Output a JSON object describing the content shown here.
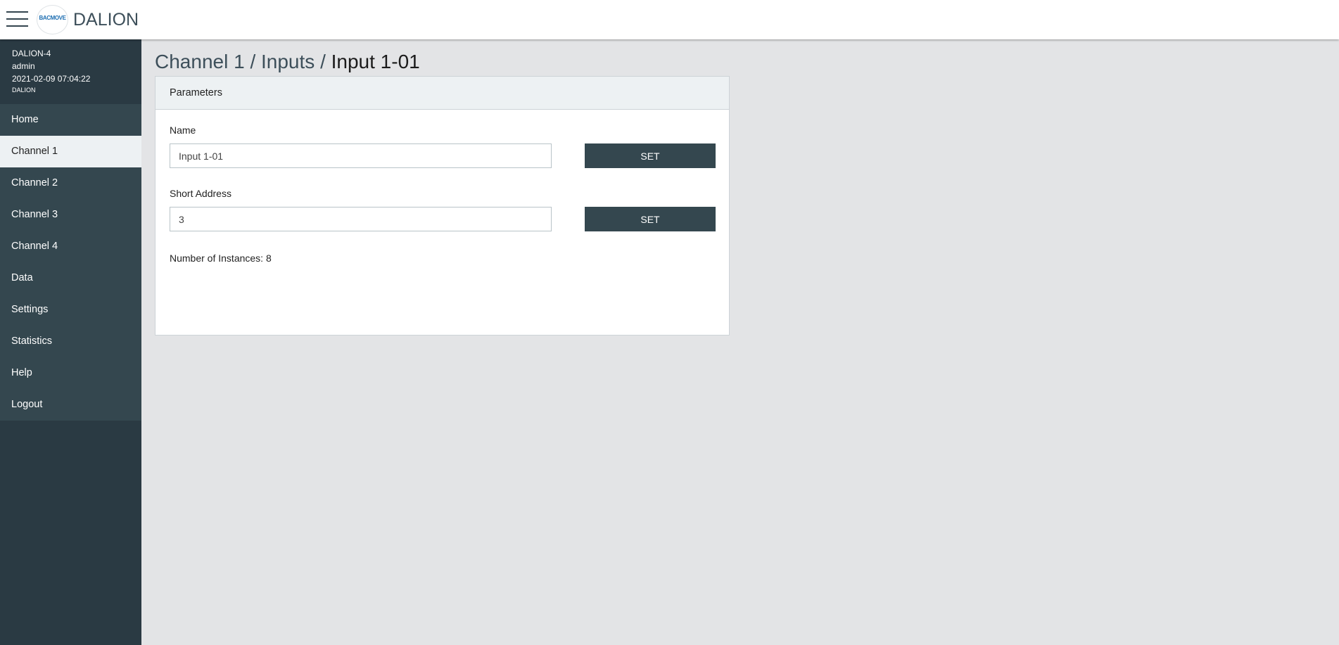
{
  "header": {
    "logo_text": "BACMOVE",
    "app_title": "DALION"
  },
  "user_info": {
    "device": "DALION-4",
    "user": "admin",
    "datetime": "2021-02-09 07:04:22",
    "product": "DALION"
  },
  "sidebar": {
    "items": [
      {
        "label": "Home"
      },
      {
        "label": "Channel 1",
        "active": true
      },
      {
        "label": "Channel 2"
      },
      {
        "label": "Channel 3"
      },
      {
        "label": "Channel 4"
      },
      {
        "label": "Data"
      },
      {
        "label": "Settings"
      },
      {
        "label": "Statistics"
      },
      {
        "label": "Help"
      },
      {
        "label": "Logout"
      }
    ]
  },
  "breadcrumb": {
    "channel": "Channel 1",
    "separator": "/",
    "section": "Inputs",
    "current": "Input 1-01"
  },
  "panel": {
    "title": "Parameters",
    "name_label": "Name",
    "name_value": "Input 1-01",
    "address_label": "Short Address",
    "address_value": "3",
    "set_label": "SET",
    "instances_text": "Number of Instances: 8"
  },
  "colors": {
    "sidebar_bg": "#2a3a43",
    "nav_bg": "#34474f",
    "button_bg": "#34474f",
    "page_bg": "#e3e4e6"
  }
}
